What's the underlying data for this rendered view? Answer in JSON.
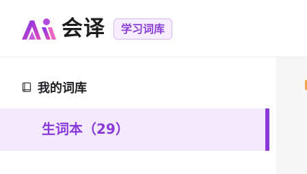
{
  "header": {
    "brand_name": "会译",
    "badge": "学习词库",
    "logo": "huiyi-logo-icon",
    "colors": {
      "brand_purple": "#8a39d9",
      "logo_gradient_start": "#7a32f0",
      "logo_gradient_end": "#e64bb8"
    }
  },
  "sidebar": {
    "section": {
      "icon": "book-icon",
      "title": "我的词库"
    },
    "items": [
      {
        "label": "生词本（29）",
        "selected": true
      }
    ]
  },
  "content": {
    "accent_color": "#f2a44a"
  }
}
